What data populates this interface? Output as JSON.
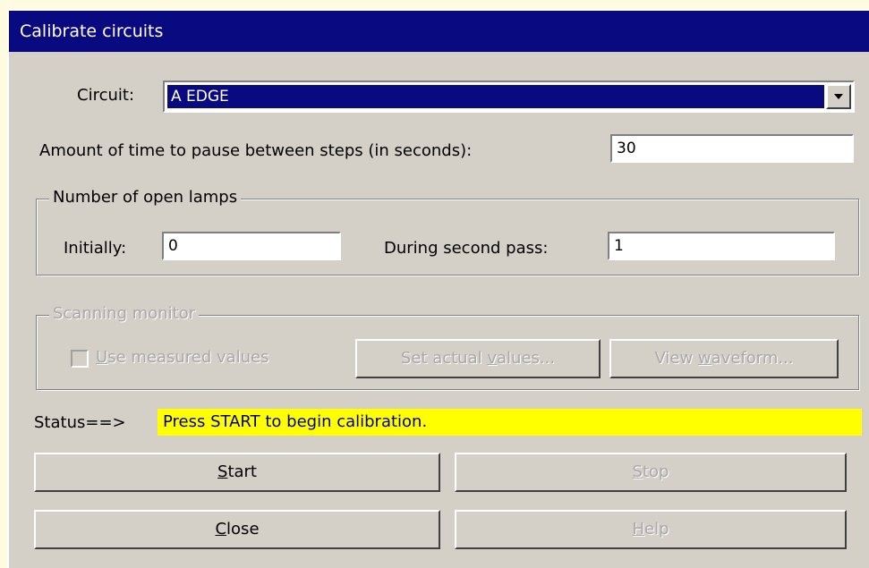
{
  "window": {
    "title": "Calibrate circuits"
  },
  "circuit": {
    "label": "Circuit:",
    "selected": "A EDGE"
  },
  "pause": {
    "label": "Amount of time to pause between steps (in seconds):",
    "value": "30"
  },
  "lamps": {
    "group_label": "Number of open lamps",
    "initially_label": "Initially:",
    "initially_value": "0",
    "second_pass_label": "During second pass:",
    "second_pass_value": "1"
  },
  "scanning": {
    "group_label": "Scanning monitor",
    "use_measured": {
      "label_underlined": "U",
      "label_rest": "se measured values",
      "checked": false,
      "enabled": false
    },
    "set_actual": {
      "pre": "Set actual ",
      "underlined": "v",
      "post": "alues...",
      "enabled": false
    },
    "view_waveform": {
      "pre": "View ",
      "underlined": "w",
      "post": "aveform...",
      "enabled": false
    }
  },
  "status": {
    "label": "Status==>",
    "message": "Press START to begin calibration."
  },
  "buttons": {
    "start": {
      "underlined": "S",
      "rest": "tart",
      "enabled": true
    },
    "stop": {
      "underlined": "S",
      "rest": "top",
      "enabled": false
    },
    "close": {
      "underlined": "C",
      "rest": "lose",
      "enabled": true
    },
    "help": {
      "underlined": "H",
      "rest": "elp",
      "enabled": false
    }
  },
  "colors": {
    "title_bar": "#0a0a80",
    "status_highlight": "#ffff00",
    "dialog": "#d4d0c8"
  }
}
